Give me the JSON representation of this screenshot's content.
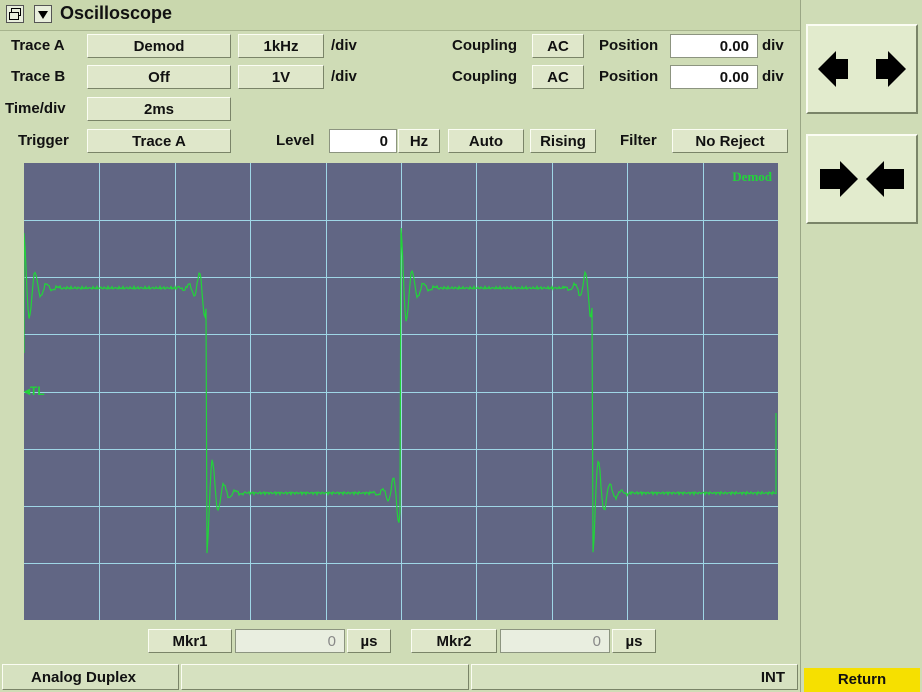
{
  "window": {
    "title": "Oscilloscope"
  },
  "trace_a": {
    "label": "Trace A",
    "source": "Demod",
    "scale": "1kHz",
    "unit": "/div",
    "coupling_label": "Coupling",
    "coupling": "AC",
    "position_label": "Position",
    "position": "0.00",
    "position_unit": "div"
  },
  "trace_b": {
    "label": "Trace B",
    "source": "Off",
    "scale": "1V",
    "unit": "/div",
    "coupling_label": "Coupling",
    "coupling": "AC",
    "position_label": "Position",
    "position": "0.00",
    "position_unit": "div"
  },
  "time": {
    "label": "Time/div",
    "value": "2ms"
  },
  "trigger": {
    "label": "Trigger",
    "source": "Trace A",
    "level_label": "Level",
    "level": "0",
    "level_unit": "Hz",
    "mode": "Auto",
    "slope": "Rising",
    "filter_label": "Filter",
    "filter": "No Reject"
  },
  "scope": {
    "trace_label": "Demod",
    "trigger_marker": "TL",
    "grid_color": "#9fd6e6",
    "trace_color": "#22d43a",
    "bg_color": "#616684"
  },
  "markers": {
    "mkr1_label": "Mkr1",
    "mkr1_value": "0",
    "mkr1_unit": "µs",
    "mkr2_label": "Mkr2",
    "mkr2_value": "0",
    "mkr2_unit": "µs"
  },
  "status": {
    "mode": "Analog Duplex",
    "ref": "INT",
    "return_label": "Return"
  },
  "side_buttons": {
    "expand": "horizontal-expand-icon",
    "compress": "horizontal-compress-icon"
  }
}
